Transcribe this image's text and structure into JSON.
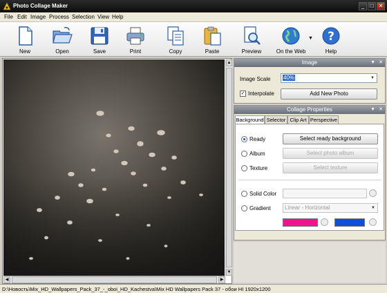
{
  "window": {
    "title": "Photo Collage Maker",
    "icon": "app-logo-icon"
  },
  "menu": [
    "File",
    "Edit",
    "Image",
    "Process",
    "Selection",
    "View",
    "Help"
  ],
  "toolbar": {
    "new": "New",
    "open": "Open",
    "save": "Save",
    "print": "Print",
    "copy": "Copy",
    "paste": "Paste",
    "preview": "Preview",
    "web": "On the Web",
    "help": "Help"
  },
  "image_panel": {
    "header": "Image",
    "scale_label": "Image Scale",
    "scale_value": "40%",
    "interpolate_label": "Interpolate",
    "interpolate_checked": true,
    "add_button": "Add New Photo"
  },
  "collage_panel": {
    "header": "Collage Properties",
    "tabs": [
      "Background",
      "Selector",
      "Clip Art",
      "Perspective"
    ],
    "active_tab": "Background",
    "ready_label": "Ready",
    "ready_button": "Select ready background",
    "album_label": "Album",
    "album_button": "Select photo album",
    "texture_label": "Texture",
    "texture_button": "Select texture",
    "solid_label": "Solid Color",
    "gradient_label": "Gradient",
    "gradient_value": "Linear - Horizontal",
    "gradient_color1": "#f0148c",
    "gradient_color2": "#0a50dc"
  },
  "status": {
    "path": "D:\\Новость\\Mix_HD_Wallpapers_Pack_37_-_oboi_HD_Kachestva\\Mix HD Wallpapers Pack 37 - обои HI  1920x1200"
  }
}
